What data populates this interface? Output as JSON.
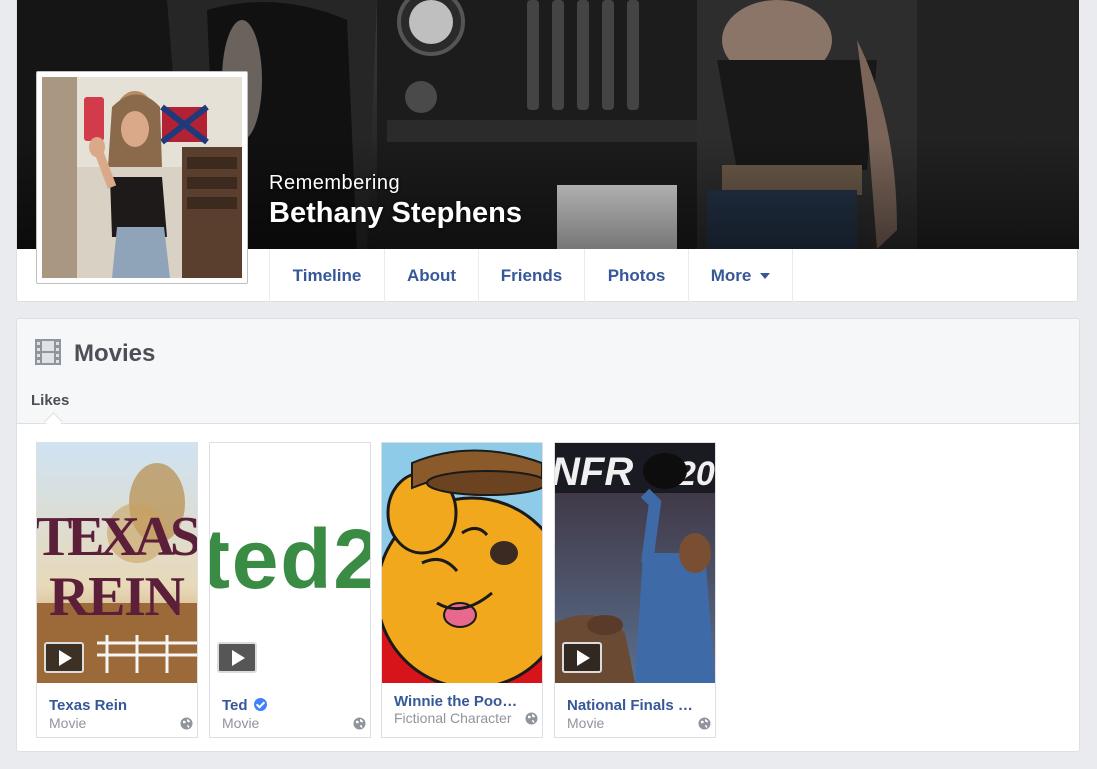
{
  "profile": {
    "memorial_label": "Remembering",
    "name": "Bethany Stephens"
  },
  "nav": {
    "items": [
      {
        "label": "Timeline"
      },
      {
        "label": "About"
      },
      {
        "label": "Friends"
      },
      {
        "label": "Photos"
      },
      {
        "label": "More"
      }
    ]
  },
  "movies": {
    "title": "Movies",
    "icon": "film-icon",
    "active_tab": "Likes",
    "items": [
      {
        "title": "Texas Rein",
        "category": "Movie",
        "verified": false,
        "has_video": true,
        "thumbnail_text": "TEXAS REIN"
      },
      {
        "title": "Ted",
        "category": "Movie",
        "verified": true,
        "has_video": true,
        "thumbnail_text": "ted2"
      },
      {
        "title": "Winnie the Pooh",
        "category": "Fictional Character",
        "verified": true,
        "has_video": false
      },
      {
        "title": "National Finals R...",
        "category": "Movie",
        "verified": false,
        "has_video": true,
        "thumbnail_text": "NFR 20"
      }
    ]
  },
  "colors": {
    "link": "#365899",
    "page_bg": "#e9ebee",
    "verified": "#4080ff",
    "secondary_text": "#90949c"
  }
}
